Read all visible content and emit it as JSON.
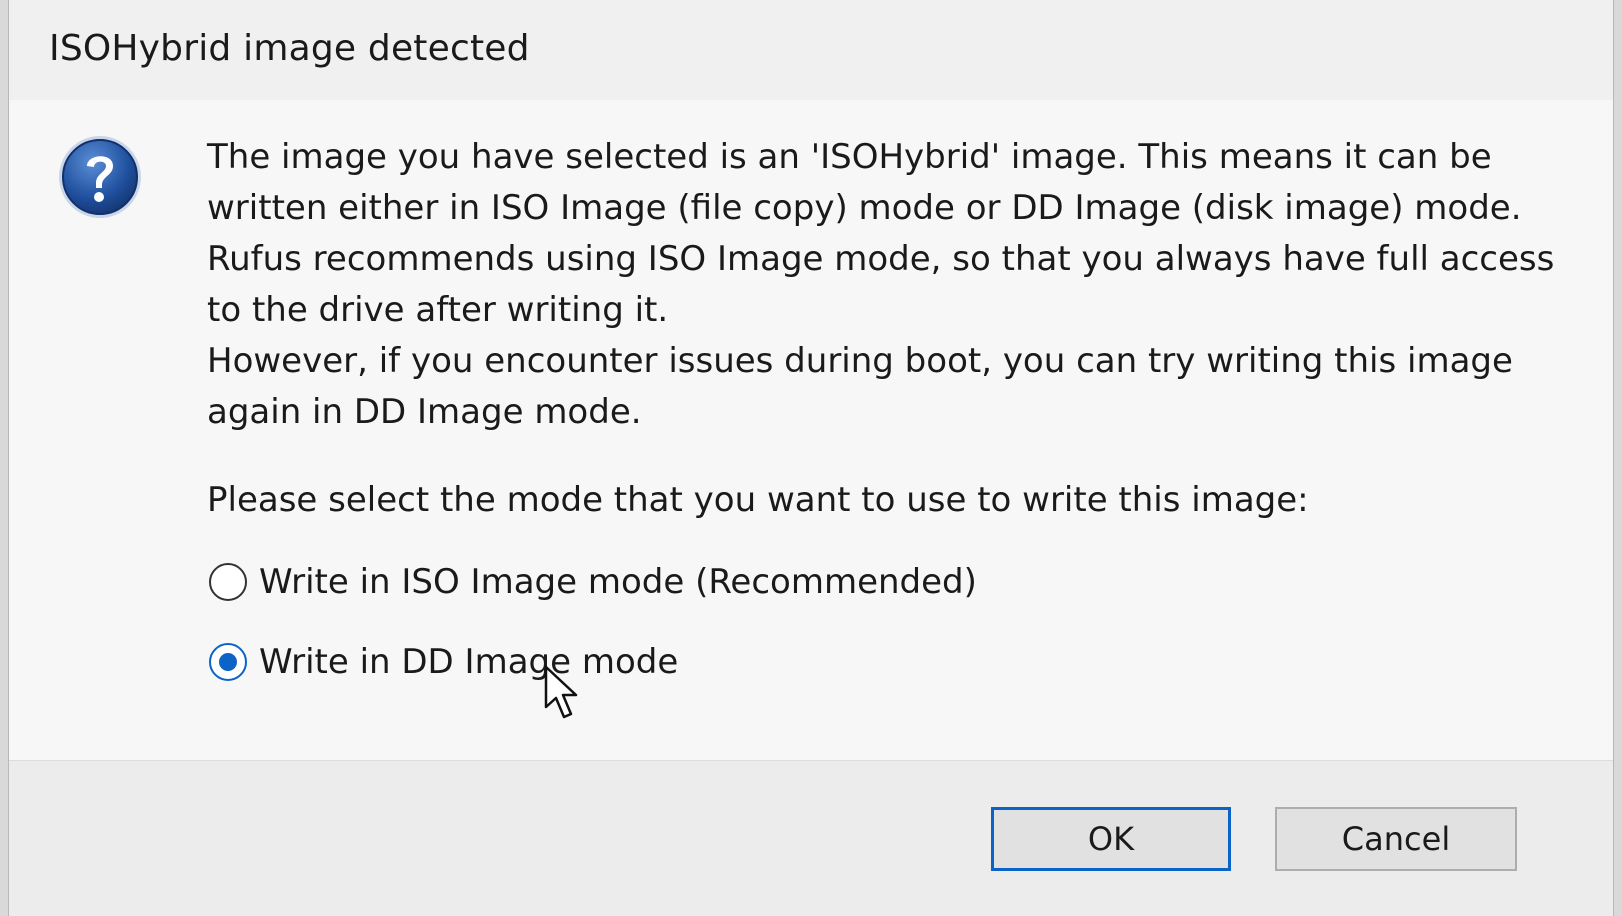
{
  "dialog": {
    "title": "ISOHybrid image detected",
    "icon": "question-icon",
    "message": {
      "line1": "The image you have selected is an 'ISOHybrid' image. This means it can be written either in ISO Image (file copy) mode or DD Image (disk image) mode.",
      "line2": "Rufus recommends using ISO Image mode, so that you always have full access to the drive after writing it.",
      "line3": "However, if you encounter issues during boot, you can try writing this image again in DD Image mode."
    },
    "prompt": "Please select the mode that you want to use to write this image:",
    "options": [
      {
        "label": "Write in ISO Image mode (Recommended)",
        "selected": false
      },
      {
        "label": "Write in DD Image mode",
        "selected": true
      }
    ],
    "buttons": {
      "ok": "OK",
      "cancel": "Cancel"
    },
    "colors": {
      "accent": "#0b63c7",
      "background": "#f0f0f0"
    }
  }
}
